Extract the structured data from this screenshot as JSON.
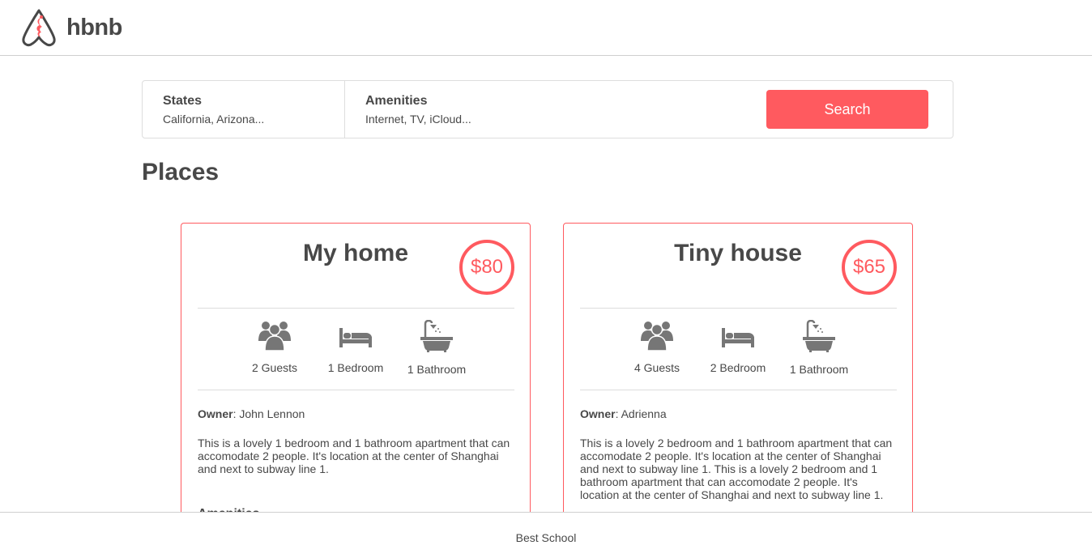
{
  "header": {
    "logo_text": "hbnb"
  },
  "filters": {
    "states": {
      "title": "States",
      "value": "California, Arizona..."
    },
    "amenities": {
      "title": "Amenities",
      "value": "Internet, TV, iCloud..."
    },
    "search_label": "Search"
  },
  "places": {
    "title": "Places",
    "items": [
      {
        "name": "My home",
        "price": "$80",
        "guests": "2 Guests",
        "bedrooms": "1 Bedroom",
        "bathrooms": "1 Bathroom",
        "owner_label": "Owner",
        "owner": ": John Lennon",
        "description": "This is a lovely 1 bedroom and 1 bathroom apartment that can accomodate 2 people. It's location at the center of Shanghai and next to subway line 1.",
        "amenities_title": "Amenities"
      },
      {
        "name": "Tiny house",
        "price": "$65",
        "guests": "4 Guests",
        "bedrooms": "2 Bedroom",
        "bathrooms": "1 Bathroom",
        "owner_label": "Owner",
        "owner": ": Adrienna",
        "description": "This is a lovely 2 bedroom and 1 bathroom apartment that can accomodate 2 people. It's location at the center of Shanghai and next to subway line 1. This is a lovely 2 bedroom and 1 bathroom apartment that can accomodate 2 people. It's location at the center of Shanghai and next to subway line 1."
      }
    ]
  },
  "footer": {
    "text": "Best School"
  },
  "colors": {
    "accent": "#ff5a5f",
    "text": "#484848",
    "border": "#dddddd"
  }
}
